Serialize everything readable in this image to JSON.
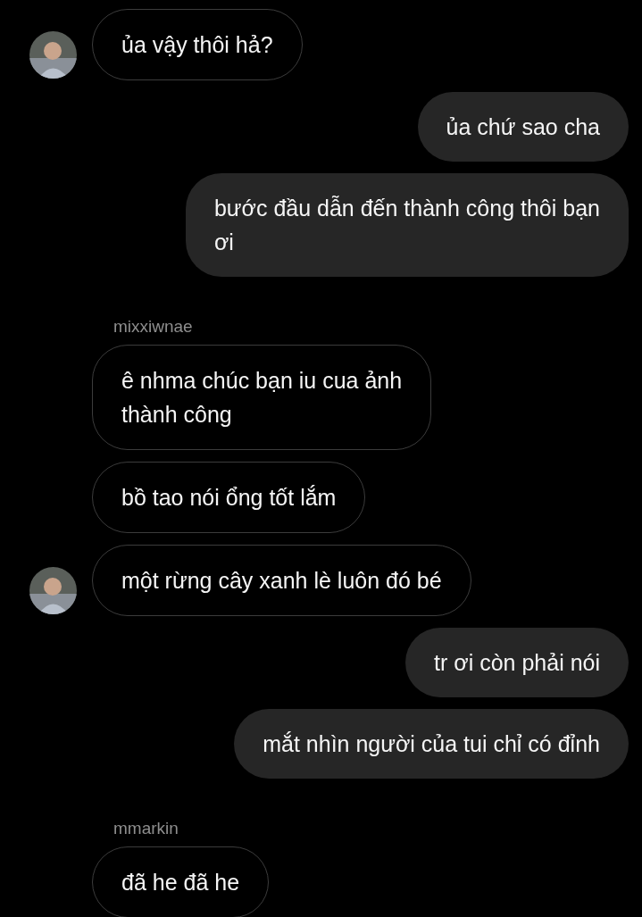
{
  "messages": [
    {
      "kind": "incoming",
      "avatar": true,
      "text": "ủa vậy thôi hả?"
    },
    {
      "kind": "outgoing",
      "text": "ủa chứ sao cha"
    },
    {
      "kind": "outgoing",
      "text": "bước đầu dẫn đến thành công thôi bạn\nơi"
    },
    {
      "kind": "sender",
      "text": "mixxiwnae"
    },
    {
      "kind": "incoming",
      "avatar": false,
      "text": "ê nhma chúc bạn iu cua ảnh\nthành công"
    },
    {
      "kind": "incoming",
      "avatar": false,
      "text": "bồ tao nói ổng tốt lắm"
    },
    {
      "kind": "incoming",
      "avatar": true,
      "text": "một rừng cây xanh lè luôn đó bé"
    },
    {
      "kind": "outgoing",
      "text": "tr ơi còn phải nói"
    },
    {
      "kind": "outgoing",
      "text": "mắt nhìn người của tui chỉ có đỉnh"
    },
    {
      "kind": "sender",
      "text": "mmarkin"
    },
    {
      "kind": "incoming",
      "avatar": false,
      "text": "đã he đã he"
    }
  ]
}
